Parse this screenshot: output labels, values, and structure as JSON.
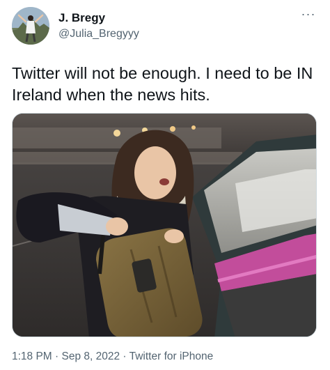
{
  "author": {
    "display_name": "J. Bregy",
    "handle": "@Julia_Bregyyy",
    "avatar_icon": "profile-photo"
  },
  "more_icon": "more-options-icon",
  "more_glyph": "···",
  "tweet": {
    "text": "Twitter will not be enough. I need to be IN Ireland when the news hits."
  },
  "media": {
    "description_icon": "photo-woman-loading-suitcase-into-car-trunk"
  },
  "meta": {
    "time": "1:18 PM",
    "separator": " · ",
    "date": "Sep 8, 2022",
    "source": "Twitter for iPhone"
  },
  "colors": {
    "text_primary": "#0f1419",
    "text_secondary": "#536471",
    "border": "#cfd9de"
  }
}
